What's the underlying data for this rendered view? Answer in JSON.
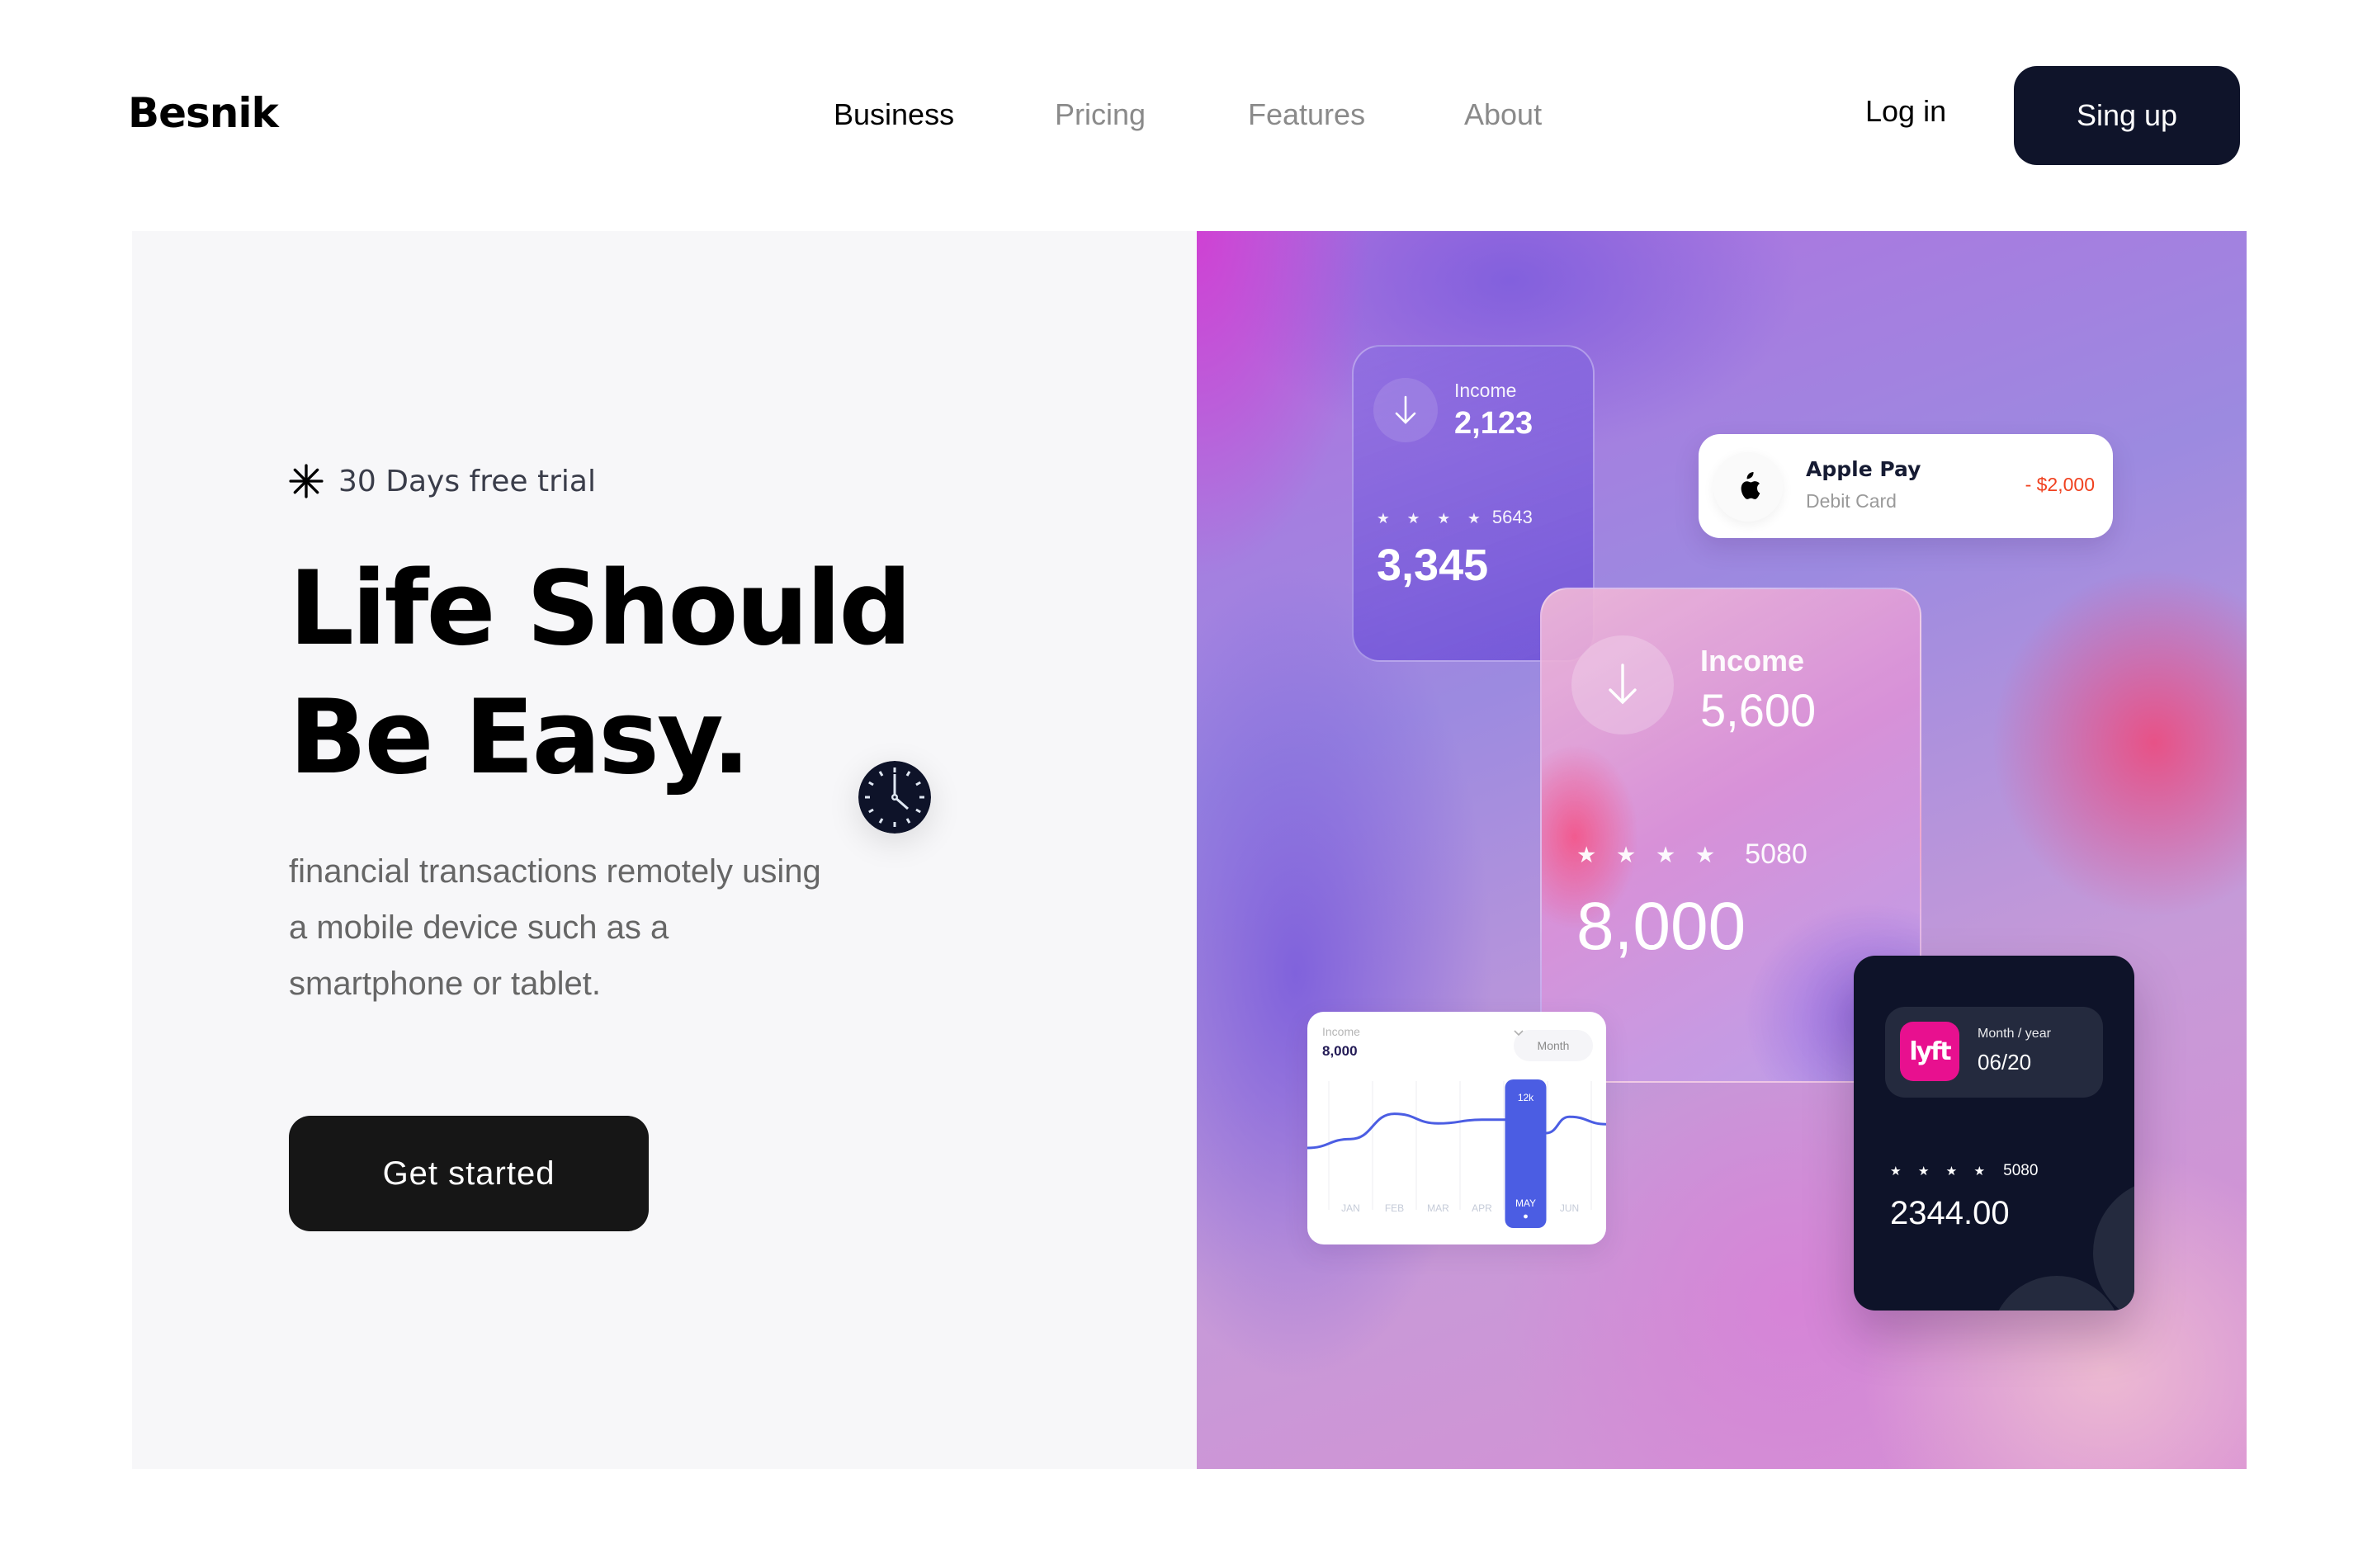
{
  "nav": {
    "logo": "Besnik",
    "links": [
      {
        "label": "Business",
        "active": true
      },
      {
        "label": "Pricing",
        "active": false
      },
      {
        "label": "Features",
        "active": false
      },
      {
        "label": "About",
        "active": false
      }
    ],
    "login_label": "Log in",
    "signup_label": "Sing up"
  },
  "hero": {
    "badge_icon": "asterisk-icon",
    "badge_text": "30 Days free trial",
    "headline_line1": "Life Should",
    "headline_line2": "Be Easy.",
    "description": "financial transactions remotely using a mobile device such as a smartphone or tablet.",
    "cta_label": "Get started",
    "decor_icon": "clock-icon"
  },
  "cards": {
    "small_income": {
      "icon": "arrow-down-icon",
      "label": "Income",
      "value": "2,123",
      "masked": "★ ★ ★ ★",
      "card_last4": "5643",
      "amount": "3,345"
    },
    "apple_pay": {
      "icon": "apple-icon",
      "title": "Apple Pay",
      "subtitle": "Debit Card",
      "amount": "- $2,000",
      "amount_color": "#f0411f"
    },
    "main_income": {
      "icon": "arrow-down-icon",
      "label": "Income",
      "value": "5,600",
      "masked": "★ ★ ★ ★",
      "card_last4": "5080",
      "amount": "8,000"
    },
    "income_chart": {
      "label": "Income",
      "value": "8,000",
      "period_select": "Month",
      "highlight_label": "12k",
      "highlight_month": "MAY",
      "accent_color": "#4b5de3"
    },
    "lyft_card": {
      "icon": "lyft-logo-icon",
      "logo_text": "lyft",
      "expiry_label": "Month / year",
      "expiry_value": "06/20",
      "masked": "★ ★ ★ ★",
      "card_last4": "5080",
      "amount": "2344.00",
      "brand_color": "#e8108f"
    }
  },
  "chart_data": {
    "type": "line",
    "title": "Income",
    "categories": [
      "JAN",
      "FEB",
      "MAR",
      "APR",
      "MAY",
      "JUN"
    ],
    "series": [
      {
        "name": "Income",
        "values": [
          6.2,
          9.6,
          8.3,
          8.8,
          12.0,
          9.2
        ]
      }
    ],
    "highlight": {
      "category": "MAY",
      "label": "12k"
    },
    "xlabel": "",
    "ylabel": "",
    "ylim": [
      0,
      14
    ],
    "grid": "vertical",
    "legend": "none"
  },
  "colors": {
    "primary_dark": "#0f142a",
    "cta_dark": "#161616",
    "chart_accent": "#4b5de3",
    "negative_amount": "#f0411f"
  }
}
